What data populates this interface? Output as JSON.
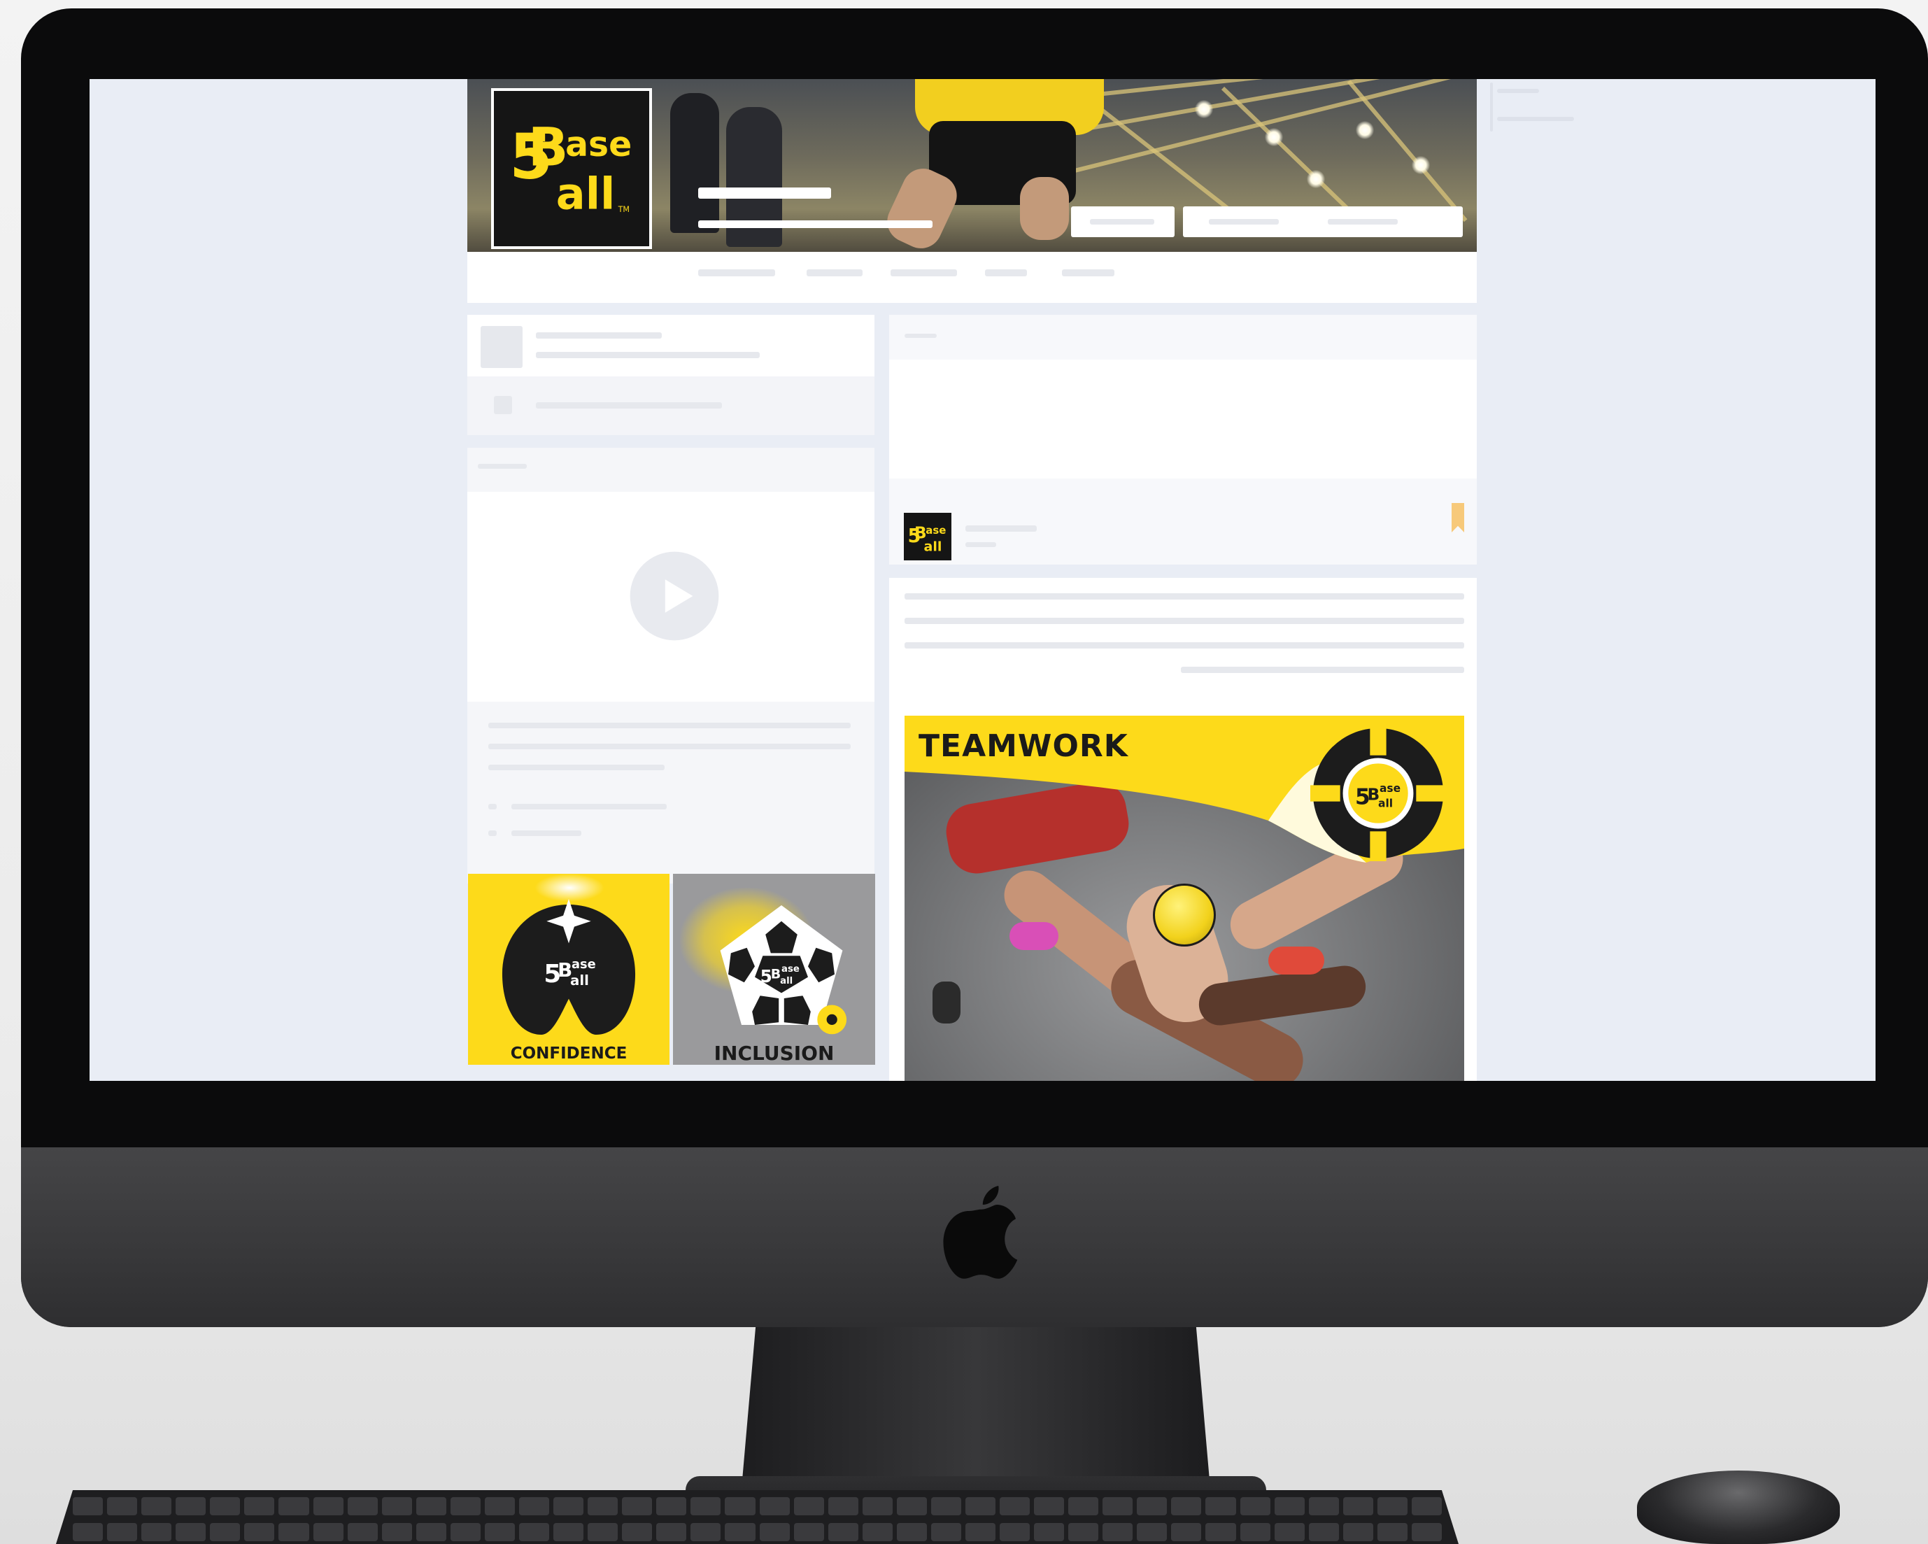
{
  "brand": {
    "name": "5 Base Ball",
    "logo_text_top": "ase",
    "logo_text_bottom": "all",
    "logo_numeral": "5",
    "logo_letter": "B",
    "trademark": "TM",
    "yellow": "#fdda1a",
    "black": "#151515"
  },
  "creatives": {
    "confidence_label": "CONFIDENCE",
    "inclusion_label": "INCLUSION",
    "teamwork_label": "TEAMWORK"
  },
  "colors": {
    "screen_bg": "#e9edf5",
    "card_bg": "#ffffff",
    "placeholder": "#e6e8ed",
    "bookmark": "#f7c97a",
    "inclusion_bg": "#9a9a9c"
  },
  "icons": {
    "video": "play-icon",
    "hardware": "apple-logo-icon"
  }
}
